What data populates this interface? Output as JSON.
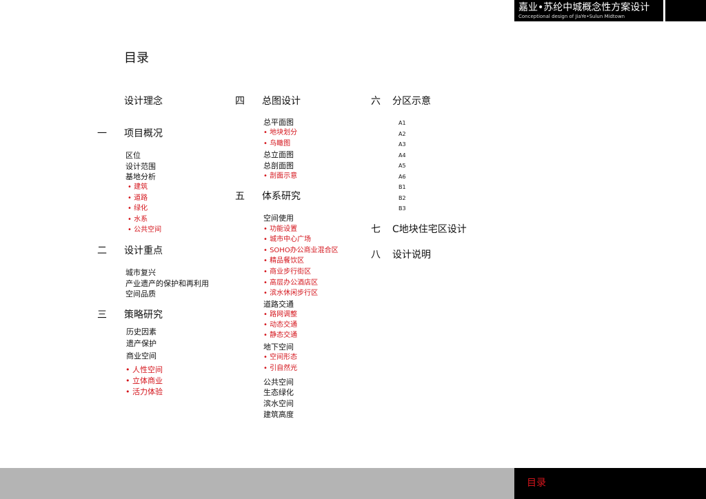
{
  "header": {
    "title_cn": "嘉业•苏纶中城概念性方案设计",
    "title_en": "Conceptional design of JiaYe•Sulun Midtown"
  },
  "page_title": "目录",
  "footer": {
    "label": "目录"
  },
  "col1": {
    "intro": "设计理念",
    "s1": {
      "num": "一",
      "title": "项目概况",
      "items": [
        "区位",
        "设计范围",
        "基地分析"
      ],
      "subs": [
        "• 建筑",
        "• 道路",
        "• 绿化",
        "• 水系",
        "• 公共空间"
      ]
    },
    "s2": {
      "num": "二",
      "title": "设计重点",
      "items": [
        "城市复兴",
        "产业遗产的保护和再利用",
        "空间品质"
      ]
    },
    "s3": {
      "num": "三",
      "title": "策略研究",
      "items": [
        "历史因素",
        "遗产保护",
        "商业空间"
      ],
      "subs": [
        "•  人性空间",
        "•  立体商业",
        "•  活力体验"
      ]
    }
  },
  "col2": {
    "s4": {
      "num": "四",
      "title": "总图设计",
      "items": [
        "总平面图",
        "• 地块划分",
        "• 鸟瞰图",
        "总立面图",
        "总剖面图",
        "• 剖面示意"
      ]
    },
    "s5": {
      "num": "五",
      "title": "体系研究",
      "items": [
        "空间使用",
        "• 功能设置",
        "• 城市中心广场",
        "• SOHO办公商业混合区",
        "• 精品餐饮区",
        "• 商业步行街区",
        "• 高层办公酒店区",
        "• 滨水休闲步行区",
        "道路交通",
        "• 路网调整",
        "• 动态交通",
        "• 静态交通",
        "地下空间",
        "• 空间形态",
        "• 引自然光",
        "公共空间",
        "生态绿化",
        "滨水空间",
        "建筑高度"
      ]
    }
  },
  "col3": {
    "s6": {
      "num": "六",
      "title": "分区示意",
      "items": [
        "A1",
        "A2",
        "A3",
        "A4",
        "A5",
        "A6",
        "B1",
        "B2",
        "B3"
      ]
    },
    "s7": {
      "num": "七",
      "title": "C地块住宅区设计"
    },
    "s8": {
      "num": "八",
      "title": "设计说明"
    }
  }
}
